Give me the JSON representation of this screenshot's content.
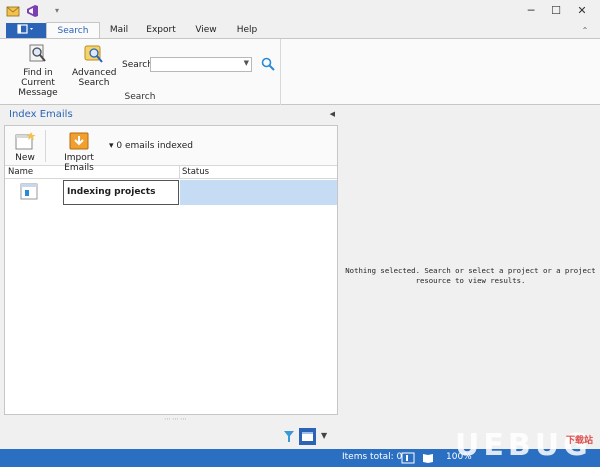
{
  "ribbon": {
    "tabs": [
      {
        "label": "Search",
        "active": true
      },
      {
        "label": "Mail",
        "active": false
      },
      {
        "label": "Export",
        "active": false
      },
      {
        "label": "View",
        "active": false
      },
      {
        "label": "Help",
        "active": false
      }
    ],
    "file_button_icon": "app-menu-icon",
    "buttons": {
      "find_current": "Find in Current Message",
      "advanced_search": "Advanced Search"
    },
    "search_label": "Search",
    "search_value": "",
    "group_label": "Search"
  },
  "index_emails": {
    "title": "Index Emails",
    "toolbar": {
      "new_label": "New",
      "import_label": "Import Emails",
      "count_text": "0 emails indexed"
    },
    "columns": [
      "Name",
      "Status"
    ],
    "rows": [
      {
        "name": "Indexing projects",
        "status": ""
      }
    ]
  },
  "results": {
    "empty_line1": "Nothing selected. Search or select a project or a project",
    "empty_line2": "resource to view results."
  },
  "statusbar": {
    "items_total": "Items total: 0",
    "zoom": "100%"
  },
  "watermark": {
    "text": "UEBUG",
    "sub": "下载站"
  },
  "colors": {
    "accent": "#2b63b7",
    "statusbar": "#2b6fc2",
    "selection": "#c5dcf4"
  }
}
